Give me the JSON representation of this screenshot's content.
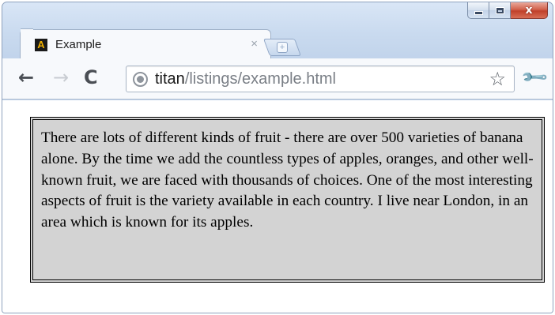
{
  "tab": {
    "title": "Example",
    "close_glyph": "×",
    "favicon_glyph": "A"
  },
  "new_tab_glyph": "+",
  "window_controls": {
    "close_glyph": "x"
  },
  "toolbar": {
    "back_glyph": "←",
    "forward_glyph": "→",
    "reload_glyph": "C",
    "star_glyph": "☆",
    "wrench_glyph": "🔧"
  },
  "omnibox": {
    "host": "titan",
    "path": "/listings/example.html"
  },
  "content": {
    "paragraph": "There are lots of different kinds of fruit - there are over 500 varieties of banana alone. By the time we add the countless types of apples, oranges, and other well-known fruit, we are faced with thousands of choices. One of the most interesting aspects of fruit is the variety available in each country. I live near London, in an area which is known for its apples."
  },
  "colors": {
    "paragraph_background": "#d3d3d3",
    "paragraph_border": "#000000",
    "close_button": "#c7432c"
  },
  "icons": [
    "globe-icon",
    "star-icon",
    "wrench-icon",
    "back-arrow-icon",
    "forward-arrow-icon",
    "reload-icon",
    "close-icon",
    "minimize-icon",
    "maximize-icon",
    "new-tab-icon"
  ]
}
